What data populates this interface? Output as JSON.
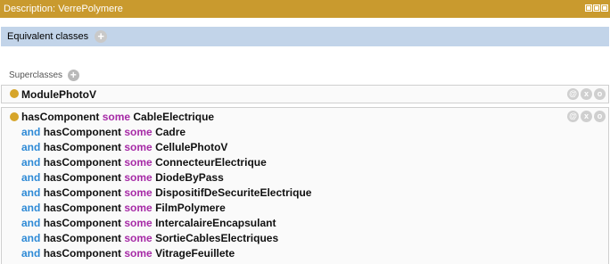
{
  "window": {
    "title": "Description: VerrePolymere"
  },
  "equivalent_classes": {
    "label": "Equivalent classes",
    "add_symbol": "+"
  },
  "superclasses": {
    "label": "Superclasses",
    "add_symbol": "+",
    "entries": [
      {
        "name": "ModulePhotoV"
      }
    ],
    "expression": {
      "first": {
        "property": "hasComponent",
        "quantifier": "some",
        "filler": "CableElectrique"
      },
      "conjunct_keyword": "and",
      "rest": [
        {
          "property": "hasComponent",
          "quantifier": "some",
          "filler": "Cadre"
        },
        {
          "property": "hasComponent",
          "quantifier": "some",
          "filler": "CellulePhotoV"
        },
        {
          "property": "hasComponent",
          "quantifier": "some",
          "filler": "ConnecteurElectrique"
        },
        {
          "property": "hasComponent",
          "quantifier": "some",
          "filler": "DiodeByPass"
        },
        {
          "property": "hasComponent",
          "quantifier": "some",
          "filler": "DispositifDeSecuriteElectrique"
        },
        {
          "property": "hasComponent",
          "quantifier": "some",
          "filler": "FilmPolymere"
        },
        {
          "property": "hasComponent",
          "quantifier": "some",
          "filler": "IntercalaireEncapsulant"
        },
        {
          "property": "hasComponent",
          "quantifier": "some",
          "filler": "SortieCablesElectriques"
        },
        {
          "property": "hasComponent",
          "quantifier": "some",
          "filler": "VitrageFeuillete"
        }
      ]
    }
  },
  "controls": {
    "annotate": "@",
    "remove": "x",
    "edit": "o"
  },
  "colors": {
    "titlebar": "#c99a2e",
    "section_header": "#c2d4e9",
    "class_dot": "#d6a52a",
    "keyword_some": "#a62aa6",
    "keyword_and": "#2e8ad6"
  },
  "icons": {
    "window_buttons": [
      "maximize-icon",
      "restore-icon",
      "close-icon"
    ],
    "class_marker": "class-dot-icon"
  }
}
